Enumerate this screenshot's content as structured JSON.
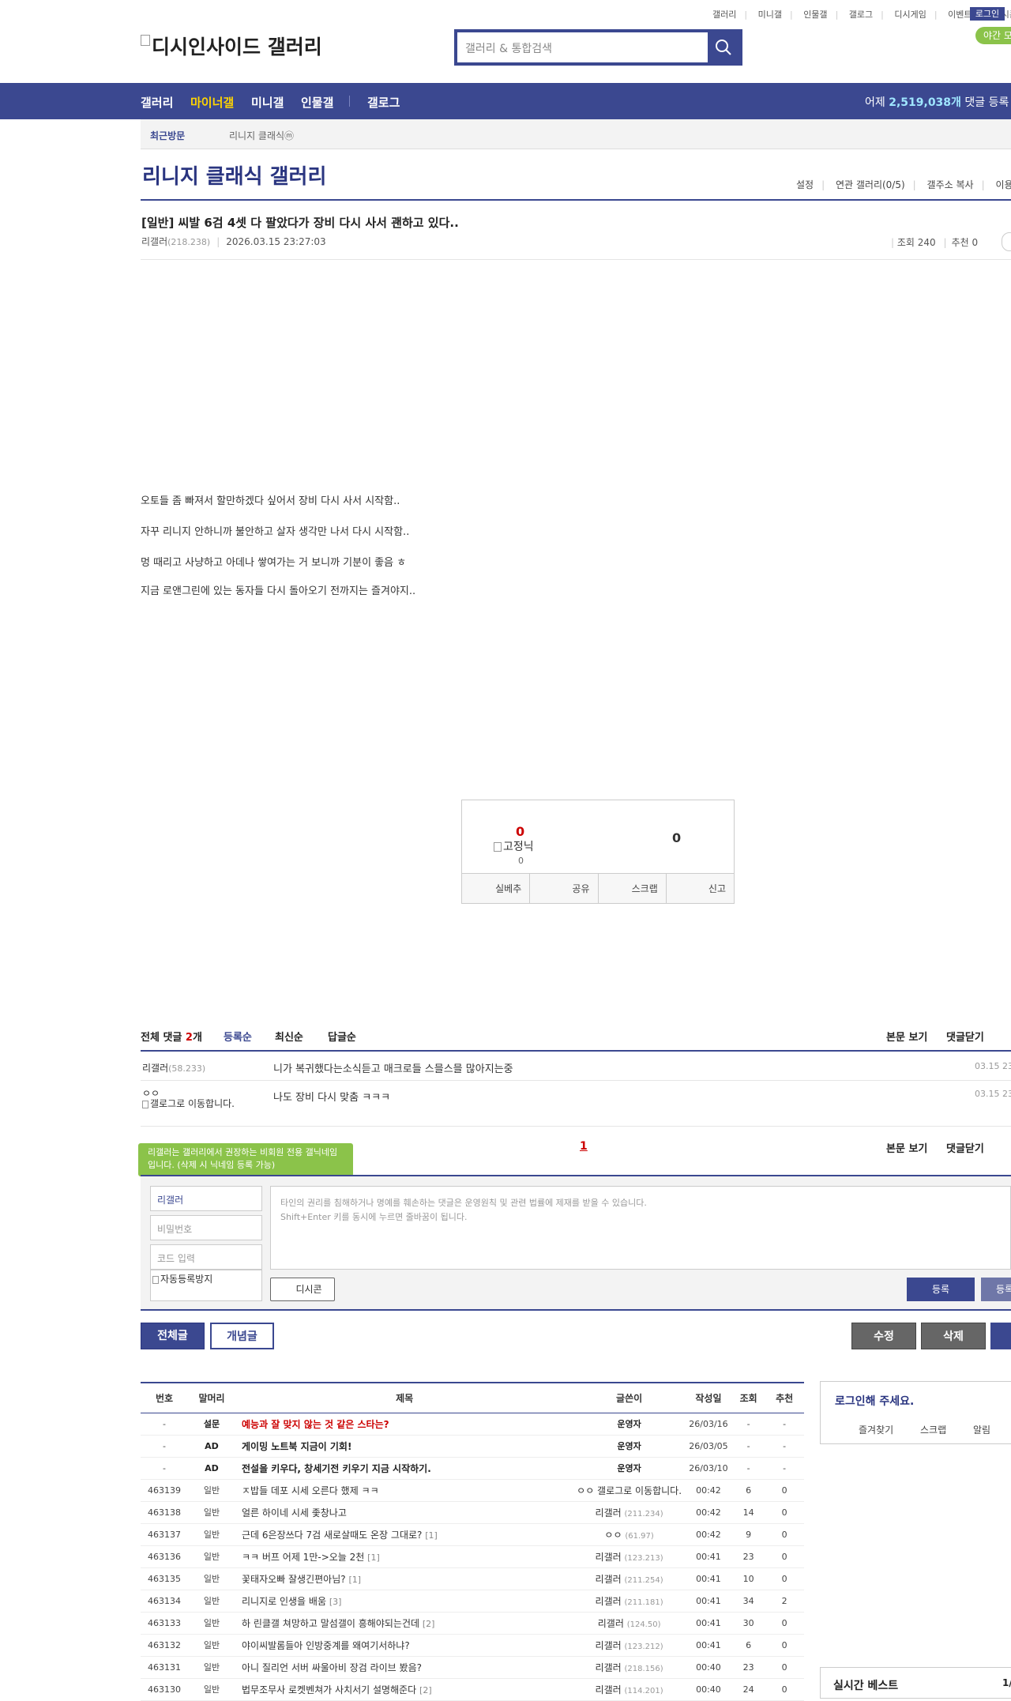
{
  "header": {
    "top_links": [
      "갤러리",
      "미니갤",
      "인물갤",
      "갤로그",
      "디시게임",
      "이벤트",
      "디시콘"
    ],
    "login": "로그인",
    "night_mode": "야간 모",
    "logo_alt": "디시인사이드 갤러리",
    "search_placeholder": "갤러리 & 통합검색"
  },
  "nav": {
    "items": [
      "갤러리",
      "마이너갤",
      "미니갤",
      "인물갤",
      "갤로그"
    ],
    "stat_prefix": "어제",
    "stat_value": "2,519,038개",
    "stat_suffix": "댓글 등록"
  },
  "visit": {
    "label": "최근방문",
    "item": "리니지 클래식ⓜ"
  },
  "gallery": {
    "title": "리니지 클래식 갤러리",
    "menu": [
      "설정",
      "연관 갤러리(0/5)",
      "갤주소 복사",
      "이용"
    ]
  },
  "post": {
    "title": "[일반] 씨발 6검 4셋 다 팔았다가 장비 다시 사서 괜하고 있다..",
    "writer": "리갤러",
    "ip": "(218.238)",
    "date": "2026.03.15 23:27:03",
    "views": "조회 240",
    "recommends": "추천 0",
    "body": [
      "오토들 좀 빠져서 할만하겠다 싶어서 장비 다시 사서 시작함..",
      "자꾸 리니지 안하니까 불안하고 살자 생각만 나서 다시 시작함..",
      "멍 때리고 사냥하고 아데나 쌓여가는 거 보니까 기분이 좋음 ㅎ",
      "지금 로앤그린에 있는 동자들 다시 돌아오기 전까지는 즐겨야지.."
    ]
  },
  "recommend": {
    "up": "0",
    "img_alt": "고정닉",
    "up_small": "0",
    "down": "0",
    "buttons": [
      "실베추",
      "공유",
      "스크랩",
      "신고"
    ]
  },
  "comments": {
    "total_label": "전체 댓글",
    "total_count": "2",
    "unit": "개",
    "sorts": [
      "등록순",
      "최신순",
      "답글순"
    ],
    "right": [
      "본문 보기",
      "댓글닫기"
    ],
    "items": [
      {
        "nick": "리갤러",
        "ip": "(58.233)",
        "text": "니가 복귀했다는소식듣고 매크로들 스믈스믈 많아지는중",
        "date": "03.15 23"
      },
      {
        "nick": "ㅇㅇ",
        "ip": "",
        "img_alt": "갤로그로 이동합니다.",
        "text": "나도 장비 다시 맞춤 ㅋㅋㅋ",
        "date": "03.15 23"
      }
    ],
    "page": "1"
  },
  "write": {
    "tooltip": "리갤러는 갤러리에서 권장하는 비회원 전용 갤닉네임입니다. (삭제 시 닉네임 등록 가능)",
    "nick_value": "리갤러",
    "pw_placeholder": "비밀번호",
    "code_placeholder": "코드 입력",
    "captcha_alt": "자동등록방지",
    "notice1": "타인의 권리를 침해하거나 명예를 훼손하는 댓글은 운영원칙 및 관련 법률에 제재를 받을 수 있습니다.",
    "notice2": "Shift+Enter 키를 동시에 누르면 줄바꿈이 됩니다.",
    "dccon": "디시콘",
    "register": "등록",
    "register2": "등록"
  },
  "actions": {
    "all": "전체글",
    "concept": "개념글",
    "edit": "수정",
    "delete": "삭제"
  },
  "list": {
    "headers": [
      "번호",
      "말머리",
      "제목",
      "글쓴이",
      "작성일",
      "조회",
      "추천"
    ],
    "rows": [
      {
        "no": "-",
        "head": "설문",
        "subj": "예능과 잘 맞지 않는 것 같은 스타는?",
        "style": "red",
        "writer": "운영자",
        "ip": "",
        "date": "26/03/16",
        "views": "-",
        "rec": "-",
        "rc": ""
      },
      {
        "no": "-",
        "head": "AD",
        "subj": "게이밍 노트북 지금이 기회!",
        "style": "bold",
        "writer": "운영자",
        "ip": "",
        "date": "26/03/05",
        "views": "-",
        "rec": "-",
        "rc": ""
      },
      {
        "no": "-",
        "head": "AD",
        "subj": "전설을 키우다, 창세기전 키우기 지금 시작하기.",
        "style": "bold",
        "writer": "운영자",
        "ip": "",
        "date": "26/03/10",
        "views": "-",
        "rec": "-",
        "rc": ""
      },
      {
        "no": "463139",
        "head": "일반",
        "subj": "ㅈ밥들 데포 시세 오른다 했제 ㅋㅋ",
        "style": "",
        "writer": "ㅇㅇ 갤로그로 이동합니다.",
        "ip": "",
        "date": "00:42",
        "views": "6",
        "rec": "0",
        "rc": ""
      },
      {
        "no": "463138",
        "head": "일반",
        "subj": "얼른 하이네 시세 좇창나고",
        "style": "",
        "writer": "리갤러",
        "ip": "(211.234)",
        "date": "00:42",
        "views": "14",
        "rec": "0",
        "rc": ""
      },
      {
        "no": "463137",
        "head": "일반",
        "subj": "근데 6은장쓰다 7검 새로살때도 온장 그대로?",
        "style": "",
        "writer": "ㅇㅇ",
        "ip": "(61.97)",
        "date": "00:42",
        "views": "9",
        "rec": "0",
        "rc": "[1]"
      },
      {
        "no": "463136",
        "head": "일반",
        "subj": "ㅋㅋ 버프 어제 1만->오늘 2천",
        "style": "",
        "writer": "리갤러",
        "ip": "(123.213)",
        "date": "00:41",
        "views": "23",
        "rec": "0",
        "rc": "[1]"
      },
      {
        "no": "463135",
        "head": "일반",
        "subj": "꽃태자오빠 잘생긴편아님?",
        "style": "",
        "writer": "리갤러",
        "ip": "(211.254)",
        "date": "00:41",
        "views": "10",
        "rec": "0",
        "rc": "[1]"
      },
      {
        "no": "463134",
        "head": "일반",
        "subj": "리니지로 인생을 배움",
        "style": "",
        "writer": "리갤러",
        "ip": "(211.181)",
        "date": "00:41",
        "views": "34",
        "rec": "2",
        "rc": "[3]"
      },
      {
        "no": "463133",
        "head": "일반",
        "subj": "하 린클갤 쳐망하고 말섬갤이 흥해야되는건데",
        "style": "",
        "writer": "리갤러",
        "ip": "(124.50)",
        "date": "00:41",
        "views": "30",
        "rec": "0",
        "rc": "[2]"
      },
      {
        "no": "463132",
        "head": "일반",
        "subj": "야이씨발롬들아 인방중계를 왜여기서하냐?",
        "style": "",
        "writer": "리갤러",
        "ip": "(123.212)",
        "date": "00:41",
        "views": "6",
        "rec": "0",
        "rc": ""
      },
      {
        "no": "463131",
        "head": "일반",
        "subj": "아니 질리언 서버 싸울아비 장검 라이브 봤음?",
        "style": "",
        "writer": "리갤러",
        "ip": "(218.156)",
        "date": "00:40",
        "views": "23",
        "rec": "0",
        "rc": ""
      },
      {
        "no": "463130",
        "head": "일반",
        "subj": "법무조무사 로켓벤쳐가 사치서기 설명해준다",
        "style": "",
        "writer": "리갤러",
        "ip": "(114.201)",
        "date": "00:40",
        "views": "24",
        "rec": "0",
        "rc": "[2]"
      }
    ]
  },
  "side": {
    "login_title": "로그인해 주세요.",
    "login_links": [
      "즐겨찾기",
      "스크랩",
      "알림"
    ],
    "best_title": "실시간 베스트",
    "best_page": "1/"
  },
  "colors": {
    "brand": "#3b4890",
    "accent": "#ffd400",
    "green": "#8bc34a"
  }
}
